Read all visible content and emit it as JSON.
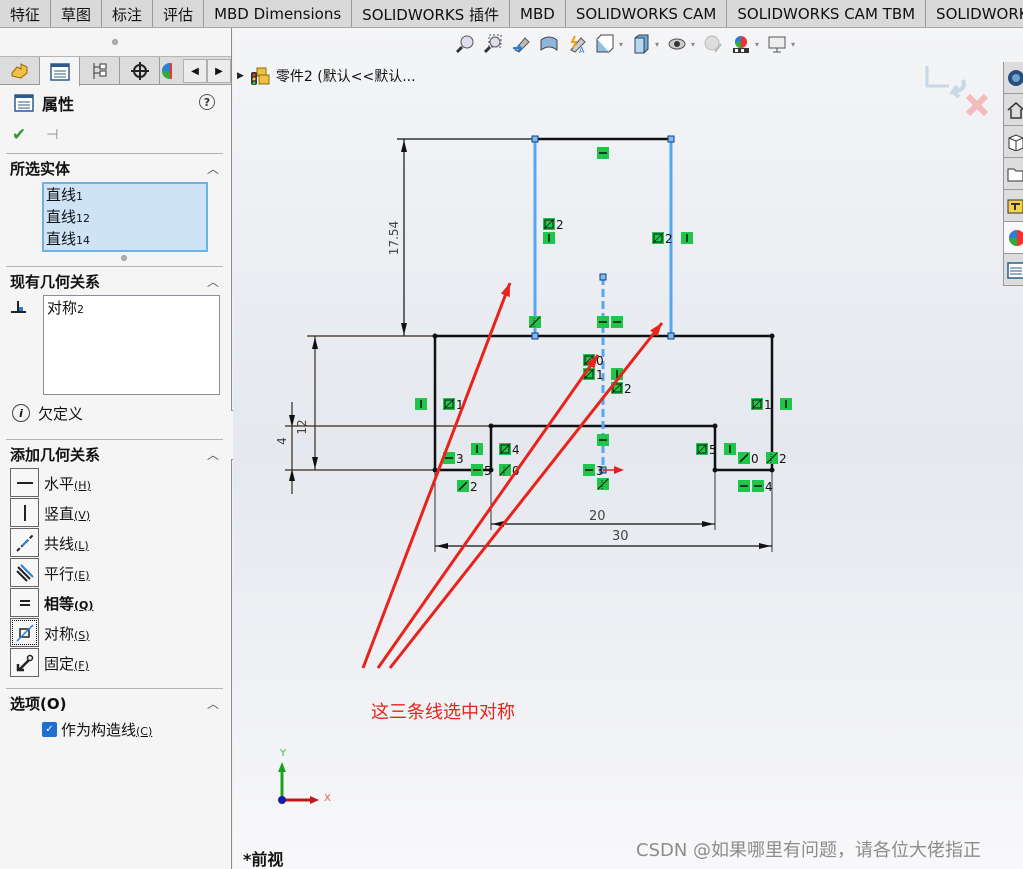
{
  "command_tabs": [
    "特征",
    "草图",
    "标注",
    "评估",
    "MBD Dimensions",
    "SOLIDWORKS 插件",
    "MBD",
    "SOLIDWORKS CAM",
    "SOLIDWORKS CAM TBM",
    "SOLIDWORKS In"
  ],
  "manager_tabs": [
    "feature-manager",
    "property-manager",
    "configuration-manager",
    "dimxpert-manager",
    "display-manager"
  ],
  "property_manager": {
    "title": "属性",
    "help": "?",
    "selected_entities": {
      "heading": "所选实体",
      "items": [
        {
          "name": "直线",
          "num": "1"
        },
        {
          "name": "直线",
          "num": "12"
        },
        {
          "name": "直线",
          "num": "14"
        }
      ]
    },
    "existing_relations": {
      "heading": "现有几何关系",
      "items": [
        {
          "name": "对称",
          "num": "2"
        }
      ],
      "status": "欠定义"
    },
    "add_relations": {
      "heading": "添加几何关系",
      "items": [
        {
          "label": "水平",
          "key": "(H)",
          "icon": "horizontal-icon",
          "bold": false
        },
        {
          "label": "竖直",
          "key": "(V)",
          "icon": "vertical-icon",
          "bold": false
        },
        {
          "label": "共线",
          "key": "(L)",
          "icon": "collinear-icon",
          "bold": false
        },
        {
          "label": "平行",
          "key": "(E)",
          "icon": "parallel-icon",
          "bold": false
        },
        {
          "label": "相等",
          "key": "(Q)",
          "icon": "equal-icon",
          "bold": true
        },
        {
          "label": "对称",
          "key": "(S)",
          "icon": "symmetric-icon",
          "bold": false
        },
        {
          "label": "固定",
          "key": "(F)",
          "icon": "fix-icon",
          "bold": false
        }
      ]
    },
    "options": {
      "heading": "选项(O)",
      "construction_label": "作为构造线",
      "construction_key": "(C)",
      "construction_checked": true
    }
  },
  "viewport": {
    "tree_item": "零件2 (默认<<默认...",
    "annotation": "这三条线选中对称",
    "view_name": "*前视",
    "watermark": "CSDN @如果哪里有问题，请各位大佬指正",
    "triad": {
      "x": "X",
      "y": "Y"
    },
    "dimensions": {
      "d1": "17.54",
      "d2": "12",
      "d3": "4",
      "d4": "20",
      "d5": "30"
    },
    "relation_badges": [
      "2",
      "2",
      "0",
      "1",
      "2",
      "1",
      "1",
      "4",
      "5",
      "3",
      "0",
      "2",
      "5",
      "0",
      "3",
      "2",
      "4"
    ]
  },
  "colors": {
    "selection_blue": "#55a6f5",
    "relation_green": "#1fc64a",
    "annotation_red": "#e8231c",
    "sketch_black": "#111111"
  }
}
